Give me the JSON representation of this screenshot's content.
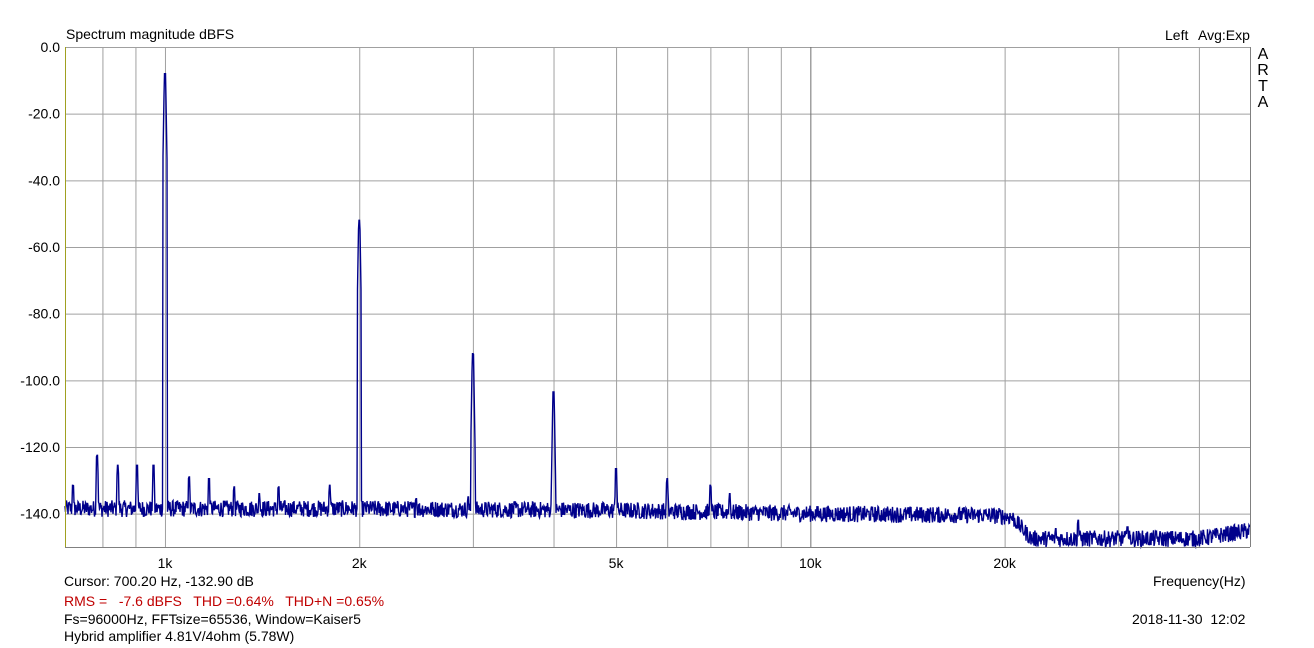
{
  "header": {
    "title": "Spectrum magnitude dBFS",
    "channel": "Left",
    "averaging": "Avg:Exp",
    "brand_letters": [
      "A",
      "R",
      "T",
      "A"
    ]
  },
  "footer": {
    "cursor": "Cursor: 700.20 Hz, -132.90 dB",
    "rms": "RMS =   -7.6 dBFS   THD =0.64%   THD+N =0.65%",
    "fft_info": "Fs=96000Hz, FFTsize=65536, Window=Kaiser5",
    "description": "Hybrid amplifier 4.81V/4ohm (5.78W)",
    "timestamp": "2018-11-30  12:02"
  },
  "colors": {
    "trace": "#00008b",
    "grid": "#a0a0a0",
    "axis_left": "#a0a020",
    "rms_text": "#c00000"
  },
  "chart_data": {
    "type": "line",
    "title": "Spectrum magnitude dBFS",
    "xlabel": "Frequency(Hz)",
    "ylabel": "",
    "x_scale": "log",
    "xlim": [
      700,
      48000
    ],
    "ylim": [
      -150,
      0
    ],
    "x_ticks": [
      {
        "value": 1000,
        "label": "1k"
      },
      {
        "value": 2000,
        "label": "2k"
      },
      {
        "value": 5000,
        "label": "5k"
      },
      {
        "value": 10000,
        "label": "10k"
      },
      {
        "value": 20000,
        "label": "20k"
      }
    ],
    "y_ticks": [
      {
        "value": 0,
        "label": "0.0"
      },
      {
        "value": -20,
        "label": "-20.0"
      },
      {
        "value": -40,
        "label": "-40.0"
      },
      {
        "value": -60,
        "label": "-60.0"
      },
      {
        "value": -80,
        "label": "-80.0"
      },
      {
        "value": -100,
        "label": "-100.0"
      },
      {
        "value": -120,
        "label": "-120.0"
      },
      {
        "value": -140,
        "label": "-140.0"
      }
    ],
    "grid": true,
    "noise_floor": [
      {
        "f": 700,
        "db": -138.5
      },
      {
        "f": 2000,
        "db": -138.5
      },
      {
        "f": 5000,
        "db": -139
      },
      {
        "f": 10000,
        "db": -140
      },
      {
        "f": 19000,
        "db": -140.5
      },
      {
        "f": 20500,
        "db": -141
      },
      {
        "f": 22000,
        "db": -147.5
      },
      {
        "f": 40000,
        "db": -147.5
      },
      {
        "f": 48000,
        "db": -145
      }
    ],
    "peaks": [
      {
        "f": 1000,
        "db": -8
      },
      {
        "f": 2000,
        "db": -52
      },
      {
        "f": 3000,
        "db": -92
      },
      {
        "f": 4000,
        "db": -103.5
      },
      {
        "f": 5000,
        "db": -126.5
      },
      {
        "f": 6000,
        "db": -129.5
      },
      {
        "f": 785,
        "db": -122.5
      },
      {
        "f": 845,
        "db": -125.5
      },
      {
        "f": 905,
        "db": -125.5
      },
      {
        "f": 960,
        "db": -125.5
      },
      {
        "f": 720,
        "db": -131.5
      },
      {
        "f": 1090,
        "db": -129
      },
      {
        "f": 1170,
        "db": -129.5
      },
      {
        "f": 1280,
        "db": -132
      },
      {
        "f": 1400,
        "db": -134
      },
      {
        "f": 1500,
        "db": -132
      },
      {
        "f": 1800,
        "db": -131.5
      },
      {
        "f": 2450,
        "db": -135.5
      },
      {
        "f": 2950,
        "db": -135
      },
      {
        "f": 7000,
        "db": -131.5
      },
      {
        "f": 7500,
        "db": -134
      },
      {
        "f": 26000,
        "db": -142
      },
      {
        "f": 31000,
        "db": -144
      },
      {
        "f": 24000,
        "db": -144.5
      }
    ]
  }
}
